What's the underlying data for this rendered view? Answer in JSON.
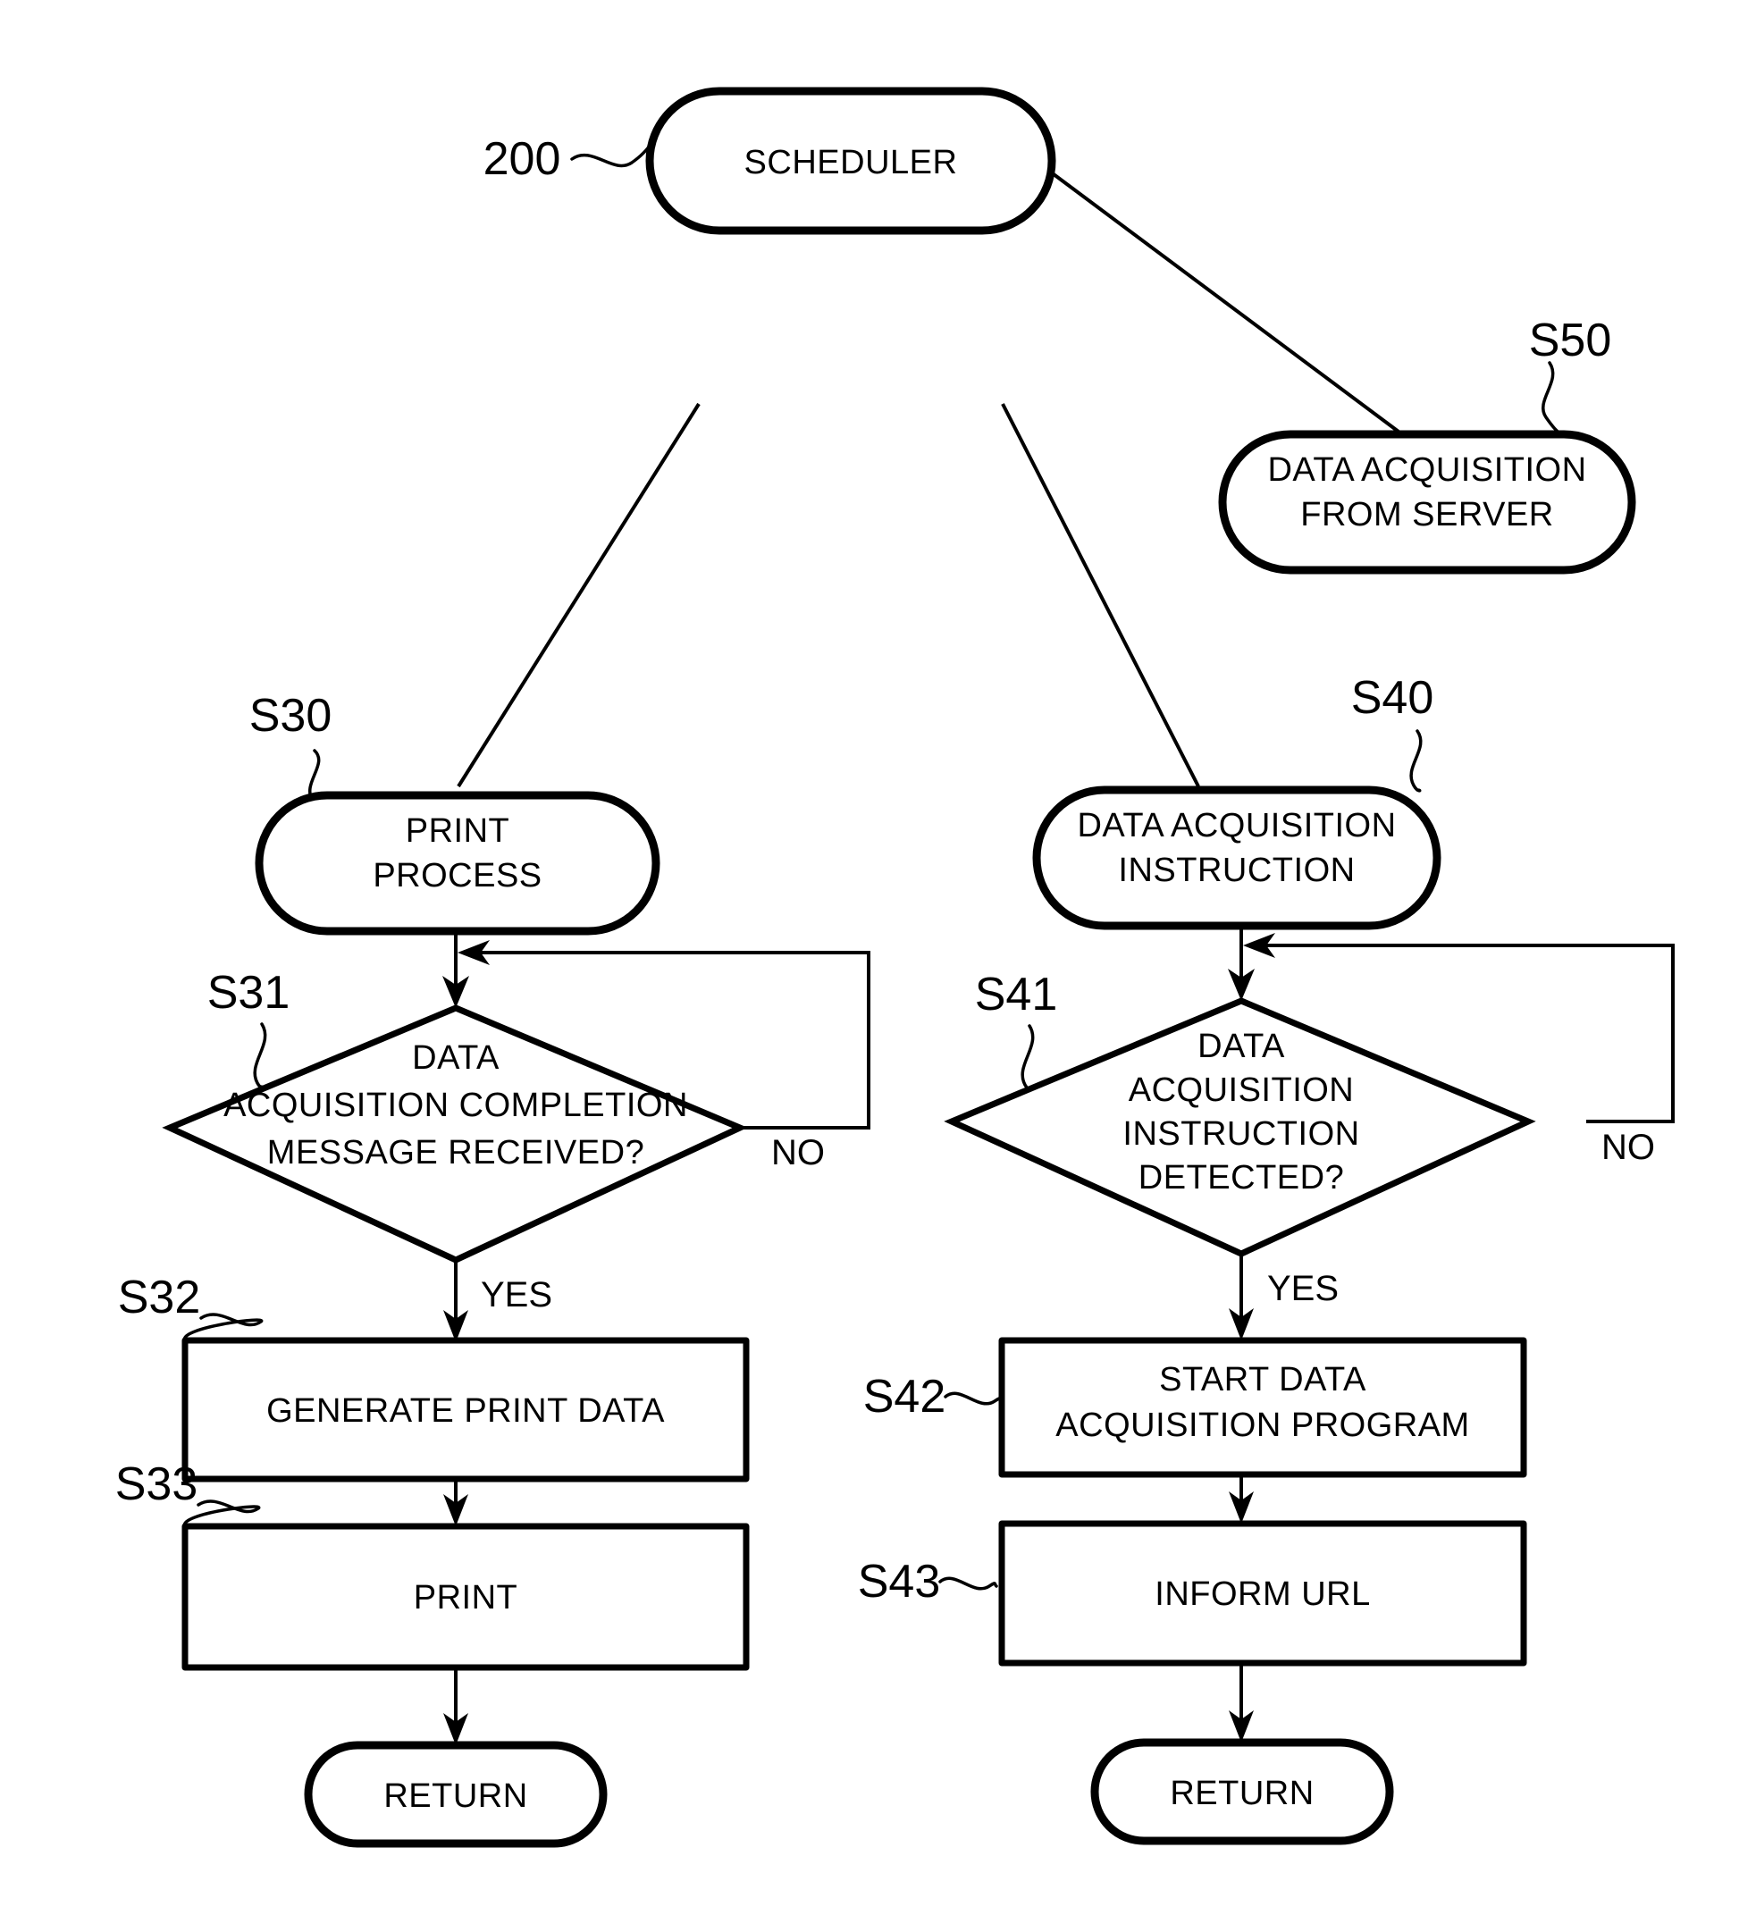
{
  "figure": {
    "type": "patent-flowchart",
    "background_color": "#ffffff",
    "line_color": "#000000"
  },
  "nodes": {
    "scheduler": {
      "ref": "200",
      "shape": "stadium",
      "lines": [
        "SCHEDULER"
      ]
    },
    "s50": {
      "ref": "S50",
      "shape": "stadium",
      "lines": [
        "DATA ACQUISITION",
        "FROM SERVER"
      ]
    },
    "s30": {
      "ref": "S30",
      "shape": "stadium",
      "lines": [
        "PRINT",
        "PROCESS"
      ]
    },
    "s40": {
      "ref": "S40",
      "shape": "stadium",
      "lines": [
        "DATA ACQUISITION",
        "INSTRUCTION"
      ]
    },
    "s31": {
      "ref": "S31",
      "shape": "diamond",
      "lines": [
        "DATA",
        "ACQUISITION COMPLETION",
        "MESSAGE RECEIVED?"
      ],
      "no_label": "NO",
      "yes_label": "YES"
    },
    "s41": {
      "ref": "S41",
      "shape": "diamond",
      "lines": [
        "DATA",
        "ACQUISITION",
        "INSTRUCTION",
        "DETECTED?"
      ],
      "no_label": "NO",
      "yes_label": "YES"
    },
    "s32": {
      "ref": "S32",
      "shape": "process",
      "lines": [
        "GENERATE PRINT DATA"
      ]
    },
    "s33": {
      "ref": "S33",
      "shape": "process",
      "lines": [
        "PRINT"
      ]
    },
    "s42": {
      "ref": "S42",
      "shape": "process",
      "lines": [
        "START DATA",
        "ACQUISITION  PROGRAM"
      ]
    },
    "s43": {
      "ref": "S43",
      "shape": "process",
      "lines": [
        "INFORM URL"
      ]
    },
    "return_left": {
      "shape": "stadium",
      "lines": [
        "RETURN"
      ]
    },
    "return_right": {
      "shape": "stadium",
      "lines": [
        "RETURN"
      ]
    }
  }
}
